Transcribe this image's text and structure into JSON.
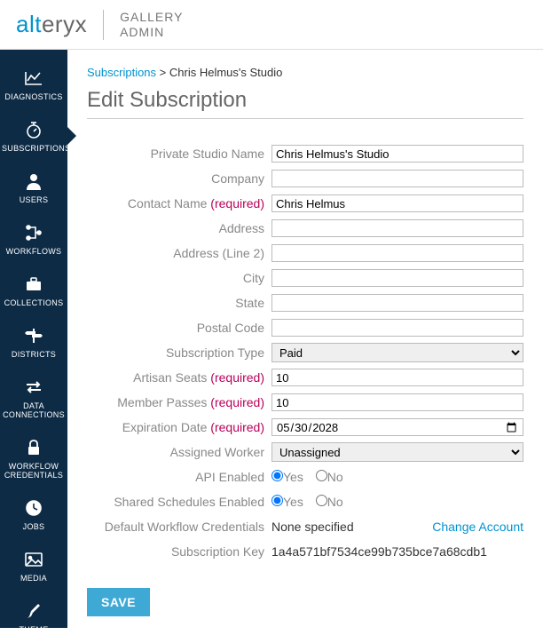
{
  "header": {
    "logo_a": "alt",
    "logo_b": "eryx",
    "sub1": "GALLERY",
    "sub2": "ADMIN"
  },
  "sidebar": {
    "items": [
      {
        "label": "DIAGNOSTICS"
      },
      {
        "label": "SUBSCRIPTIONS"
      },
      {
        "label": "USERS"
      },
      {
        "label": "WORKFLOWS"
      },
      {
        "label": "COLLECTIONS"
      },
      {
        "label": "DISTRICTS"
      },
      {
        "label": "DATA CONNECTIONS"
      },
      {
        "label": "WORKFLOW CREDENTIALS"
      },
      {
        "label": "JOBS"
      },
      {
        "label": "MEDIA"
      },
      {
        "label": "THEME"
      }
    ]
  },
  "breadcrumb": {
    "root": "Subscriptions",
    "sep": " > ",
    "current": "Chris Helmus's Studio"
  },
  "page_title": "Edit Subscription",
  "form": {
    "private_studio_name": {
      "label": "Private Studio Name",
      "value": "Chris Helmus's Studio"
    },
    "company": {
      "label": "Company",
      "value": ""
    },
    "contact_name": {
      "label": "Contact Name",
      "req": "(required)",
      "value": "Chris Helmus"
    },
    "address": {
      "label": "Address",
      "value": ""
    },
    "address2": {
      "label": "Address (Line 2)",
      "value": ""
    },
    "city": {
      "label": "City",
      "value": ""
    },
    "state": {
      "label": "State",
      "value": ""
    },
    "postal": {
      "label": "Postal Code",
      "value": ""
    },
    "sub_type": {
      "label": "Subscription Type",
      "value": "Paid"
    },
    "artisan": {
      "label": "Artisan Seats",
      "req": "(required)",
      "value": "10"
    },
    "member": {
      "label": "Member Passes",
      "req": "(required)",
      "value": "10"
    },
    "expiration": {
      "label": "Expiration Date",
      "req": "(required)",
      "value": "2028-05-30"
    },
    "worker": {
      "label": "Assigned Worker",
      "value": "Unassigned"
    },
    "api": {
      "label": "API Enabled",
      "yes": "Yes",
      "no": "No"
    },
    "shared": {
      "label": "Shared Schedules Enabled",
      "yes": "Yes",
      "no": "No"
    },
    "cred": {
      "label": "Default Workflow Credentials",
      "value": "None specified",
      "change": "Change Account"
    },
    "key": {
      "label": "Subscription Key",
      "value": "1a4a571bf7534ce99b735bce7a68cdb1"
    }
  },
  "save_label": "SAVE"
}
